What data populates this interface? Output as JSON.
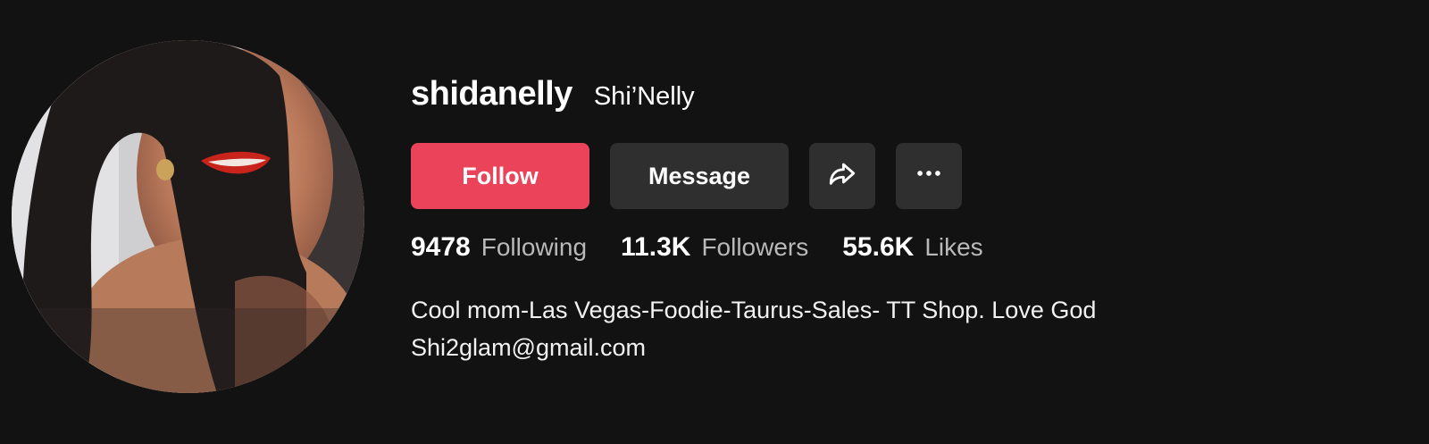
{
  "profile": {
    "username": "shidanelly",
    "nickname": "Shi’Nelly",
    "avatar_icon": "profile-photo"
  },
  "actions": {
    "follow_label": "Follow",
    "message_label": "Message",
    "share_icon": "share-arrow-icon",
    "more_icon": "more-dots-icon"
  },
  "stats": [
    {
      "value": "9478",
      "label": "Following"
    },
    {
      "value": "11.3K",
      "label": "Followers"
    },
    {
      "value": "55.6K",
      "label": "Likes"
    }
  ],
  "bio": {
    "line1": "Cool mom-Las Vegas-Foodie-Taurus-Sales- TT Shop. Love God",
    "line2": "Shi2glam@gmail.com"
  },
  "colors": {
    "background": "#121212",
    "follow_button": "#ea435a",
    "secondary_button": "#2f2f2f",
    "stat_label": "#b9b9b9"
  }
}
